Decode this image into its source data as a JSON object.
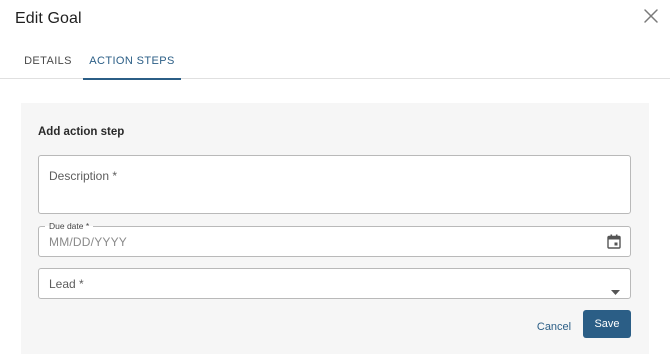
{
  "dialog": {
    "title": "Edit Goal",
    "close_icon": "close-icon"
  },
  "tabs": [
    {
      "label": "DETAILS",
      "active": false
    },
    {
      "label": "ACTION STEPS",
      "active": true
    }
  ],
  "panel": {
    "heading": "Add action step",
    "description": {
      "placeholder": "Description *",
      "value": ""
    },
    "due_date": {
      "label": "Due date *",
      "placeholder": "MM/DD/YYYY",
      "value": "",
      "icon": "calendar-icon"
    },
    "lead": {
      "placeholder": "Lead *",
      "value": "",
      "icon": "chevron-down-icon"
    },
    "cancel_label": "Cancel",
    "save_label": "Save"
  },
  "colors": {
    "accent": "#2b5e86",
    "panel_bg": "#f6f6f6",
    "border": "#b9b9b9"
  }
}
